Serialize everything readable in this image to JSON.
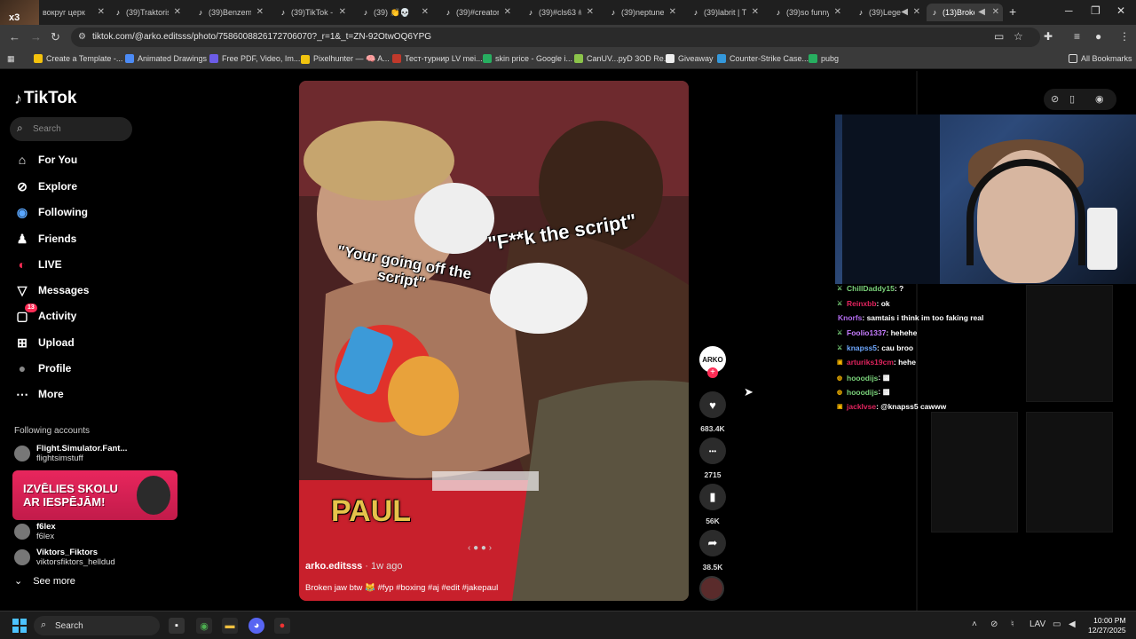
{
  "browser": {
    "profile_badge": "x3",
    "tabs": [
      {
        "title": "вокруг церк",
        "fav": "♪"
      },
      {
        "title": "(39)Traktoris",
        "fav": "♪"
      },
      {
        "title": "(39)Benzem",
        "fav": "♪"
      },
      {
        "title": "(39)TikTok -",
        "fav": "♪"
      },
      {
        "title": "(39) 👏💀",
        "fav": "♪"
      },
      {
        "title": "(39)#creator",
        "fav": "♪"
      },
      {
        "title": "(39)#cls63 #",
        "fav": "♪"
      },
      {
        "title": "(39)neptune",
        "fav": "♪"
      },
      {
        "title": "(39)labrit | T",
        "fav": "♪"
      },
      {
        "title": "(39)so funny",
        "fav": "♪"
      },
      {
        "title": "(39)Legen",
        "fav": "♪"
      },
      {
        "title": "(13)Broke",
        "fav": "♪"
      }
    ],
    "url": "tiktok.com/@arko.editsss/photo/7586008826172706070?_r=1&_t=ZN-92OtwOQ6YPG",
    "bookmarks": [
      {
        "label": "Create a Template -...",
        "color": "#f4c20d"
      },
      {
        "label": "Animated Drawings",
        "color": "#4c8bf5"
      },
      {
        "label": "Free PDF, Video, Im...",
        "color": "#6c5ce7"
      },
      {
        "label": "Pixelhunter — 🧠 A...",
        "color": "#f1c40f"
      },
      {
        "label": "Тест-турнир LV mei...",
        "color": "#c0392b"
      },
      {
        "label": "skin price - Google i...",
        "color": "#27ae60"
      },
      {
        "label": "CanUV...pyD 3OD Re...",
        "color": "#8bc34a"
      },
      {
        "label": "Giveaway",
        "color": "#eeeeee"
      },
      {
        "label": "Counter-Strike Case...",
        "color": "#3498db"
      },
      {
        "label": "pubg",
        "color": "#27ae60"
      }
    ],
    "all_bookmarks": "All Bookmarks"
  },
  "tiktok": {
    "logo": "TikTok",
    "search_placeholder": "Search",
    "nav": [
      {
        "label": "For You",
        "icon": "home-icon",
        "glyph": "⌂"
      },
      {
        "label": "Explore",
        "icon": "compass-icon",
        "glyph": "⊘"
      },
      {
        "label": "Following",
        "icon": "following-icon",
        "glyph": "◉"
      },
      {
        "label": "Friends",
        "icon": "friends-icon",
        "glyph": "♟"
      },
      {
        "label": "LIVE",
        "icon": "live-icon",
        "glyph": "◐"
      },
      {
        "label": "Messages",
        "icon": "messages-icon",
        "glyph": "▽"
      },
      {
        "label": "Activity",
        "icon": "activity-icon",
        "glyph": "▢"
      },
      {
        "label": "Upload",
        "icon": "upload-icon",
        "glyph": "⊞"
      },
      {
        "label": "Profile",
        "icon": "profile-icon",
        "glyph": "●"
      },
      {
        "label": "More",
        "icon": "more-icon",
        "glyph": "⋯"
      }
    ],
    "activity_badge": "13",
    "following_title": "Following accounts",
    "accounts": [
      {
        "name": "Flight.Simulator.Fant...",
        "handle": "flightsimstuff"
      },
      {
        "name": "f6lex",
        "handle": "f6lex"
      },
      {
        "name": "Viktors_Fiktors",
        "handle": "viktorsfiktors_helldud"
      }
    ],
    "ad_line1": "IZVĒLIES SKOLU",
    "ad_line2": "AR IESPĒJĀM!",
    "see_more": "See more",
    "video": {
      "caption_left": "\"Your going off the script\"",
      "caption_right": "\"F**k the script\"",
      "author": "arko.editsss",
      "age": " · 1w ago",
      "description": "Broken jaw btw 😹 #fyp #boxing #aj #edit #jakepaul",
      "trunks_text": "PAUL"
    },
    "creator_avatar_text": "ARKO",
    "actions": [
      {
        "icon": "heart-icon",
        "glyph": "♥",
        "count": "683.4K"
      },
      {
        "icon": "comment-icon",
        "glyph": "•••",
        "count": "2715"
      },
      {
        "icon": "bookmark-icon",
        "glyph": "▮",
        "count": "56K"
      },
      {
        "icon": "share-icon",
        "glyph": "➦",
        "count": "38.5K"
      }
    ]
  },
  "stream": {
    "chat": [
      {
        "user": "ChillDaddy15",
        "msg": ": ?",
        "color": "#7ad27a",
        "icon": "⚔"
      },
      {
        "user": "Reinxbb",
        "msg": ": ok",
        "color": "#e0245e",
        "icon": "⚔"
      },
      {
        "user": "Knorfs",
        "msg": ": samtais i think im too faking real",
        "color": "#b46cf0",
        "icon": ""
      },
      {
        "user": "Foolio1337",
        "msg": ": hehehe",
        "color": "#c77dff",
        "icon": "⚔"
      },
      {
        "user": "knapss5",
        "msg": ": cau broo",
        "color": "#6ea8ff",
        "icon": "⚔"
      },
      {
        "user": "arturiks19cm",
        "msg": ": hehe",
        "color": "#e0245e",
        "icon": "▣"
      },
      {
        "user": "hooodijs",
        "msg": ": ▩",
        "color": "#7ad27a",
        "icon": "◍"
      },
      {
        "user": "hooodijs",
        "msg": ": ▩",
        "color": "#7ad27a",
        "icon": "◍"
      },
      {
        "user": "jacklvse",
        "msg": ": @knapss5 cawww",
        "color": "#e0245e",
        "icon": "▣"
      }
    ]
  },
  "taskbar": {
    "search_placeholder": "Search",
    "lang": "LAV",
    "time": "10:00 PM",
    "date": "12/27/2025"
  }
}
